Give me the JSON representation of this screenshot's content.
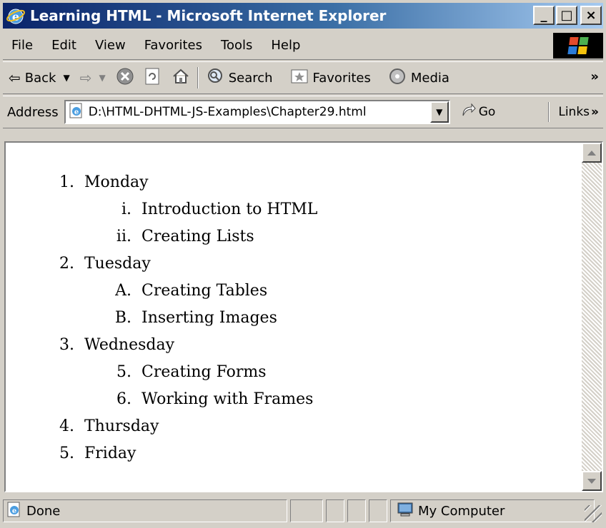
{
  "window": {
    "title": "Learning HTML - Microsoft Internet Explorer",
    "controls": {
      "minimize": "_",
      "maximize": "□",
      "close": "×"
    }
  },
  "menu": [
    "File",
    "Edit",
    "View",
    "Favorites",
    "Tools",
    "Help"
  ],
  "toolbar": {
    "back_label": "Back",
    "search_label": "Search",
    "favorites_label": "Favorites",
    "media_label": "Media",
    "more": "»"
  },
  "address": {
    "label": "Address",
    "value": "D:\\HTML-DHTML-JS-Examples\\Chapter29.html",
    "go_label": "Go",
    "links_label": "Links",
    "links_more": "»"
  },
  "document": {
    "list": [
      {
        "marker": "1.",
        "text": "Monday",
        "children": [
          {
            "marker": "i.",
            "text": "Introduction to HTML"
          },
          {
            "marker": "ii.",
            "text": "Creating Lists"
          }
        ]
      },
      {
        "marker": "2.",
        "text": "Tuesday",
        "children": [
          {
            "marker": "A.",
            "text": "Creating Tables"
          },
          {
            "marker": "B.",
            "text": "Inserting Images"
          }
        ]
      },
      {
        "marker": "3.",
        "text": "Wednesday",
        "children": [
          {
            "marker": "5.",
            "text": "Creating Forms"
          },
          {
            "marker": "6.",
            "text": "Working with Frames"
          }
        ]
      },
      {
        "marker": "4.",
        "text": "Thursday",
        "children": []
      },
      {
        "marker": "5.",
        "text": "Friday",
        "children": []
      }
    ]
  },
  "status": {
    "text": "Done",
    "zone": "My Computer"
  },
  "colors": {
    "title_start": "#0a246a",
    "title_end": "#a6caf0",
    "chrome": "#d4d0c8"
  }
}
